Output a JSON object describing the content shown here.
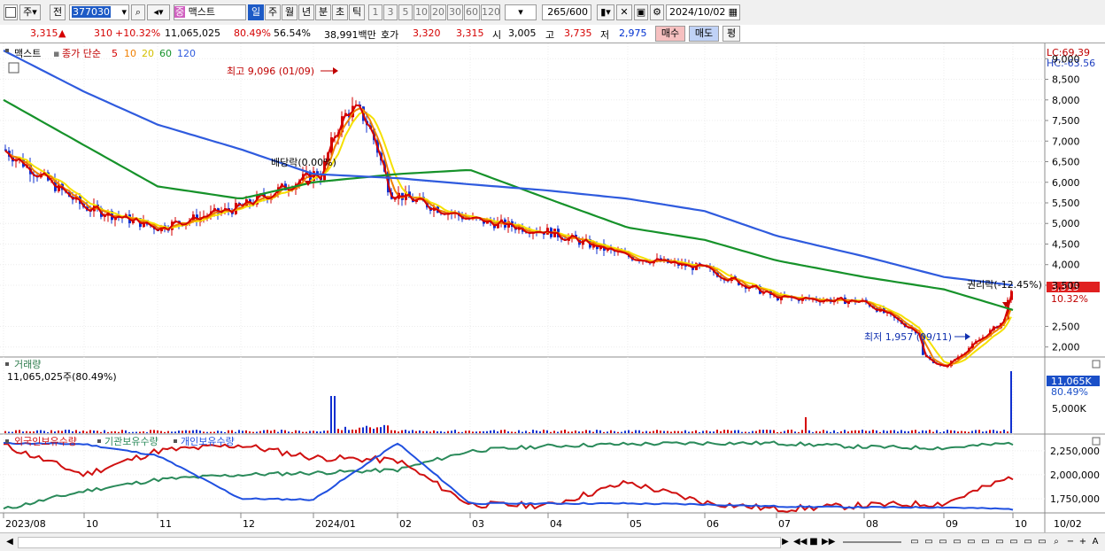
{
  "toolbar": {
    "market": "주",
    "prev": "전",
    "code": "377030",
    "name": "맥스트",
    "name_badge": "중",
    "periods": [
      "일",
      "주",
      "월",
      "년",
      "분",
      "초",
      "틱"
    ],
    "selected_period": "일",
    "intervals": [
      "1",
      "3",
      "5",
      "10",
      "20",
      "30",
      "60",
      "120"
    ],
    "count": "265",
    "count_total": "/600",
    "date": "2024/10/02"
  },
  "quote": {
    "price": "3,315",
    "arrow": "▲",
    "change": "310",
    "change_pct": "+10.32%",
    "volume": "11,065,025",
    "vol_ratio": "80.49%",
    "turnover": "56.54%",
    "amount": "38,991백만",
    "hoga_label": "호가",
    "ask": "3,320",
    "bid": "3,315",
    "open_label": "시",
    "open": "3,005",
    "high_label": "고",
    "high": "3,735",
    "low_label": "저",
    "low": "2,975",
    "buy": "매수",
    "sell": "매도",
    "eval": "평"
  },
  "legend": {
    "name": "맥스트",
    "price_label": "종가 단순",
    "ma": [
      "5",
      "10",
      "20",
      "60",
      "120"
    ],
    "volume_title": "거래량",
    "volume_value": "11,065,025주(80.49%)",
    "holders": [
      "외국인보유수량",
      "기관보유수량",
      "개인보유수량"
    ]
  },
  "annotations": {
    "high": "최고 9,096 (01/09)",
    "low": "최저 1,957 (09/11)",
    "dividend": "배당락(0.00%)",
    "rights": "권리락(-12.45%)"
  },
  "right_axis": {
    "lc": "LC:69,39",
    "hc": "HC:-63.56",
    "price_ticks": [
      "9,000",
      "8,500",
      "8,000",
      "7,500",
      "7,000",
      "6,500",
      "6,000",
      "5,500",
      "5,000",
      "4,500",
      "4,000",
      "3,500",
      "2,500",
      "2,000"
    ],
    "price_badge": "3,315",
    "price_badge_pct": "10.32%",
    "volume_badge": "11,065K",
    "volume_badge_pct": "80.49%",
    "volume_tick": "5,000K",
    "holder_ticks": [
      "2,250,000",
      "2,000,000",
      "1,750,000"
    ]
  },
  "x_axis": [
    "2023/08",
    "10",
    "11",
    "12",
    "2024/01",
    "02",
    "03",
    "04",
    "05",
    "06",
    "07",
    "08",
    "09",
    "10",
    "10/02"
  ],
  "colors": {
    "ma5": "#d40000",
    "ma10": "#f07f00",
    "ma20": "#f5e000",
    "ma60": "#16922a",
    "ma120": "#2f5bde",
    "up": "#d50000",
    "down": "#1030d0",
    "foreign": "#d01010",
    "inst": "#2a8a5a",
    "indiv": "#2050e0"
  },
  "chart_data": {
    "type": "line",
    "title": "맥스트",
    "x": [
      "2023/08",
      "10",
      "11",
      "12",
      "2024/01",
      "02",
      "03",
      "04",
      "05",
      "06",
      "07",
      "08",
      "09",
      "10"
    ],
    "series": [
      {
        "name": "종가",
        "values": [
          6800,
          5400,
          4900,
          5400,
          6200,
          5700,
          5100,
          4800,
          4200,
          3900,
          3200,
          3100,
          2000,
          3315
        ]
      },
      {
        "name": "120",
        "values": [
          9200,
          8200,
          7400,
          6800,
          6200,
          6100,
          5950,
          5800,
          5600,
          5300,
          4700,
          4200,
          3700,
          3500
        ]
      },
      {
        "name": "60",
        "values": [
          8000,
          6900,
          5900,
          5600,
          6000,
          6200,
          6300,
          5600,
          4900,
          4600,
          4100,
          3700,
          3400,
          2900
        ]
      }
    ],
    "ylim": [
      1800,
      9200
    ]
  }
}
